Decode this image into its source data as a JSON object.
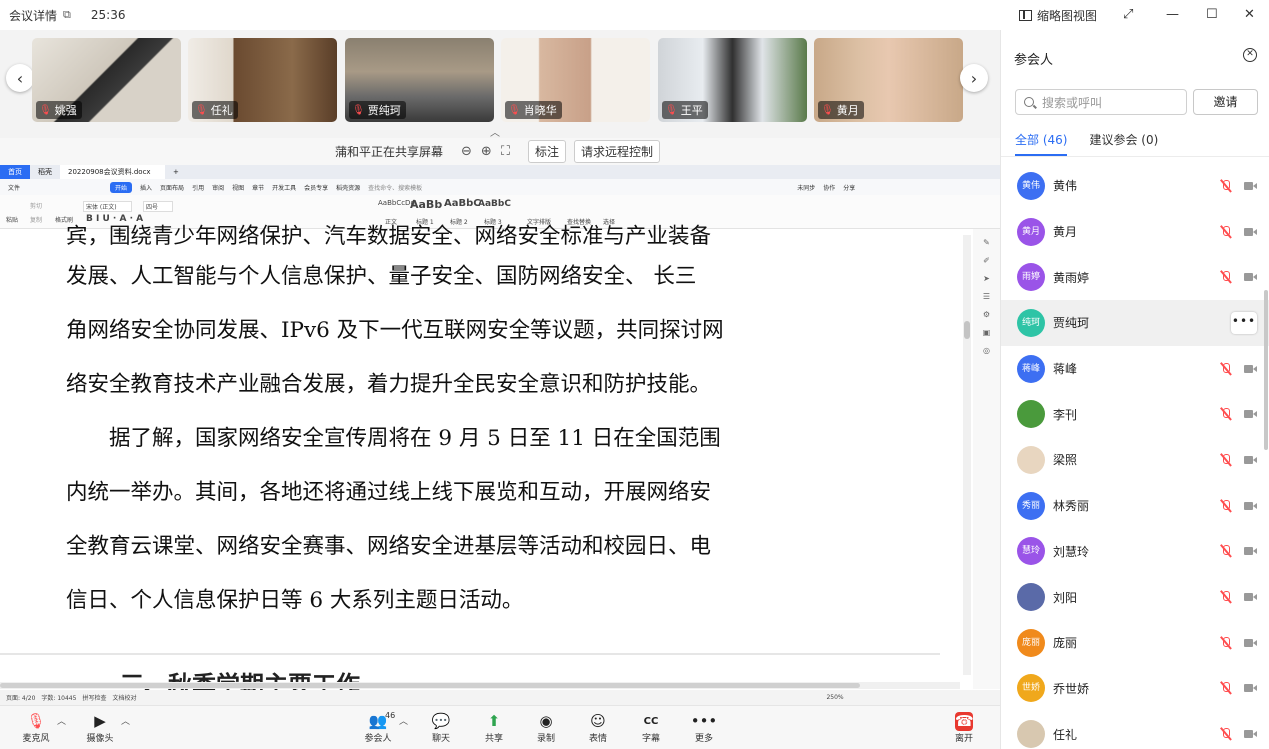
{
  "titlebar": {
    "title": "会议详情",
    "timer": "25:36",
    "thumbnail_view": "缩略图视图"
  },
  "video_strip": {
    "tiles": [
      {
        "name": "姚强"
      },
      {
        "name": "任礼"
      },
      {
        "name": "贾纯珂"
      },
      {
        "name": "肖晓华"
      },
      {
        "name": "王平"
      },
      {
        "name": "黄月"
      }
    ]
  },
  "share_bar": {
    "text": "蒲和平正在共享屏幕",
    "annotate": "标注",
    "remote_control": "请求远程控制"
  },
  "wps": {
    "tabs": [
      "首页",
      "稻壳",
      "20220908会议资料.docx"
    ],
    "menu": [
      "文件",
      "开始",
      "插入",
      "页面布局",
      "引用",
      "审阅",
      "视图",
      "章节",
      "开发工具",
      "会员专享",
      "稻壳资源",
      "查找命令、搜索模板"
    ],
    "menu_right": [
      "未同步",
      "协作",
      "分享"
    ],
    "ribbon": {
      "paste": "粘贴",
      "cut": "剪切",
      "copy": "复制",
      "format_painter": "格式刷",
      "font": "宋体 (正文)",
      "size": "四号",
      "styles": [
        "正文",
        "标题 1",
        "标题 2",
        "标题 3"
      ],
      "text_layout": "文字排版",
      "find_replace": "查找替换",
      "select": "选择"
    },
    "doc_lines": [
      "宾，围绕青少年网络保护、汽车数据安全、网络安全标准与产业装备",
      "发展、人工智能与个人信息保护、量子安全、国防网络安全、 长三",
      "角网络安全协同发展、IPv6 及下一代互联网安全等议题，共同探讨网",
      "络安全教育技术产业融合发展，着力提升全民安全意识和防护技能。",
      "　　据了解，国家网络安全宣传周将在 9 月 5 日至 11 日在全国范围",
      "内统一举办。其间，各地还将通过线上线下展览和互动，开展网络安",
      "全教育云课堂、网络安全赛事、网络安全进基层等活动和校园日、电",
      "信日、个人信息保护日等 6 大系列主题日活动。"
    ],
    "heading": "三、秋季学期主要工作",
    "status": {
      "page": "页面: 4/20",
      "words": "字数: 10445",
      "spell": "拼写检查",
      "proof": "文档校对",
      "zoom": "250%"
    }
  },
  "toolbar": {
    "mic": "麦克风",
    "camera": "摄像头",
    "participants": "参会人",
    "participants_count": "46",
    "chat": "聊天",
    "share": "共享",
    "record": "录制",
    "emoji": "表情",
    "caption": "字幕",
    "more": "更多",
    "leave": "离开"
  },
  "panel": {
    "title": "参会人",
    "search_placeholder": "搜索或呼叫",
    "invite": "邀请",
    "tab_all": "全部 (46)",
    "tab_suggested": "建议参会 (0)",
    "participants": [
      {
        "name": "黄伟",
        "avatar": "黄伟",
        "color": "#3d6ff2"
      },
      {
        "name": "黄月",
        "avatar": "黄月",
        "color": "#9a54e8"
      },
      {
        "name": "黄雨婷",
        "avatar": "雨婷",
        "color": "#9a54e8"
      },
      {
        "name": "贾纯珂",
        "avatar": "纯珂",
        "color": "#2ec4a6"
      },
      {
        "name": "蒋峰",
        "avatar": "蒋峰",
        "color": "#3d6ff2"
      },
      {
        "name": "李刊",
        "avatar": "",
        "color": "#4a9a3c"
      },
      {
        "name": "梁照",
        "avatar": "",
        "color": "#e8d6c0"
      },
      {
        "name": "林秀丽",
        "avatar": "秀丽",
        "color": "#3d6ff2"
      },
      {
        "name": "刘慧玲",
        "avatar": "慧玲",
        "color": "#9a54e8"
      },
      {
        "name": "刘阳",
        "avatar": "",
        "color": "#5a6aa8"
      },
      {
        "name": "庞丽",
        "avatar": "庞丽",
        "color": "#f08a1c"
      },
      {
        "name": "乔世娇",
        "avatar": "世娇",
        "color": "#f0a81c"
      },
      {
        "name": "任礼",
        "avatar": "",
        "color": "#d8c8b0"
      }
    ]
  }
}
